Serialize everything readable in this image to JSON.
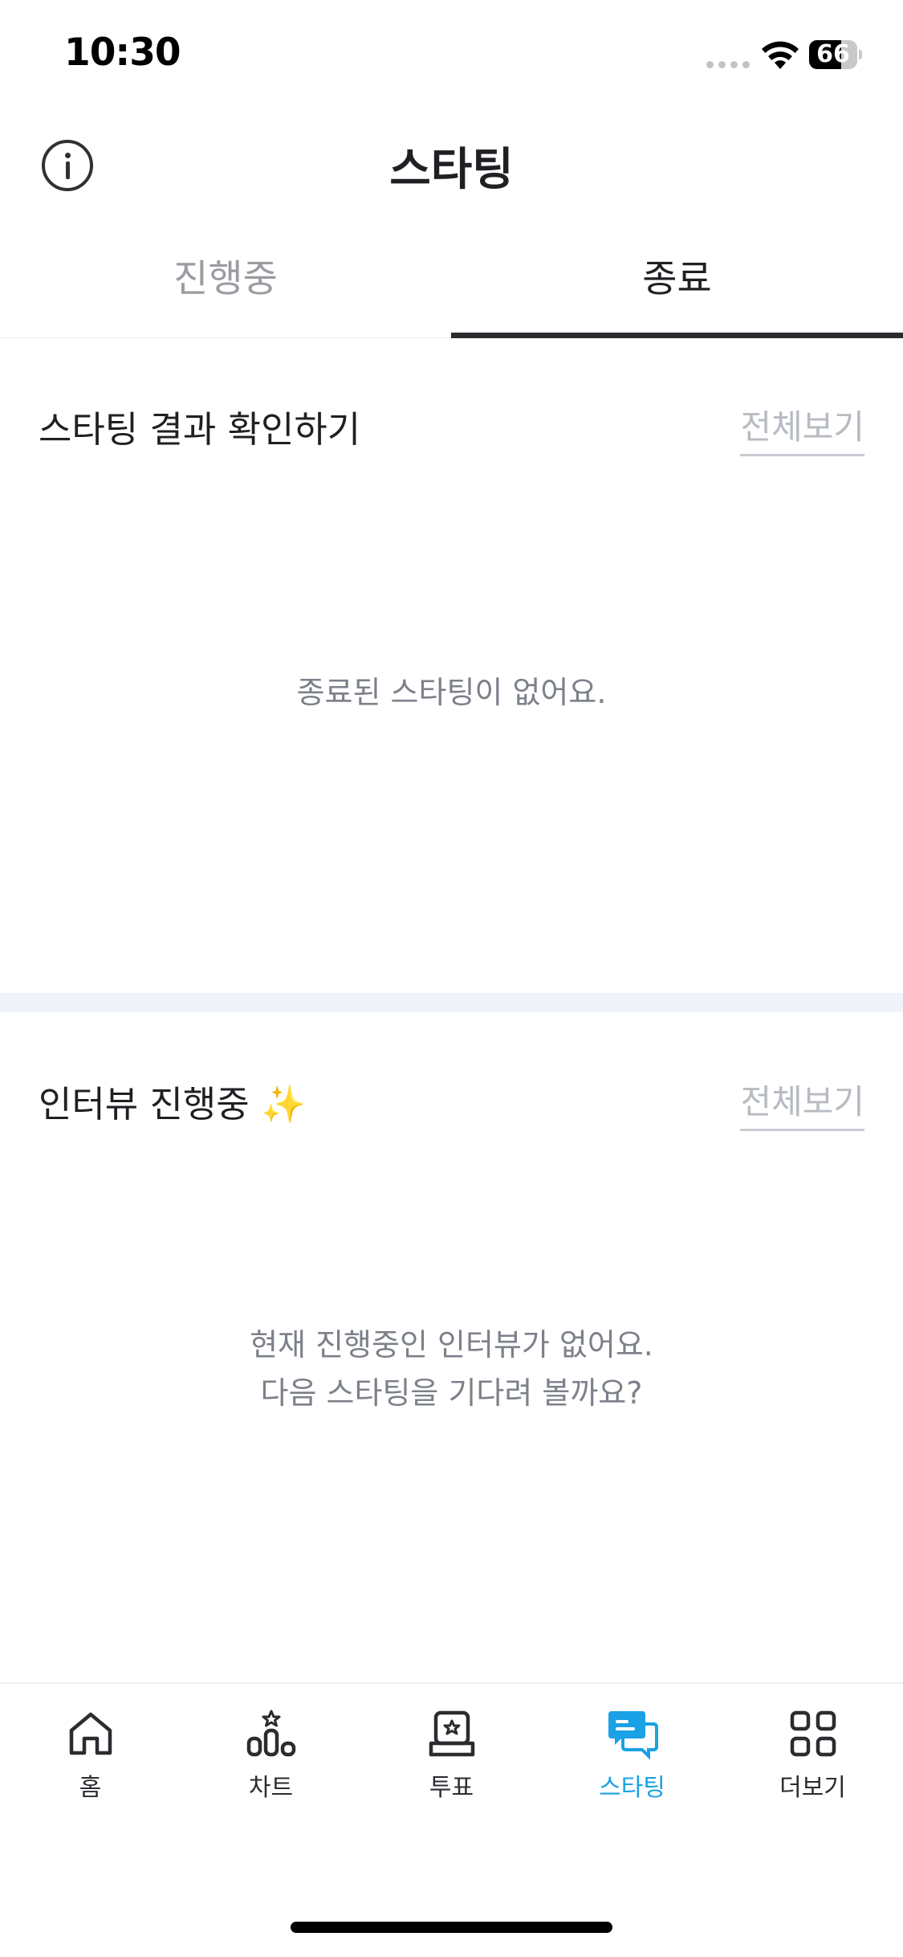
{
  "status_bar": {
    "time": "10:30",
    "battery_percent": 66,
    "battery_label": "66"
  },
  "header": {
    "title": "스타팅",
    "info_icon": "info-circle-icon"
  },
  "tabs": [
    {
      "label": "진행중",
      "active": false
    },
    {
      "label": "종료",
      "active": true
    }
  ],
  "results_section": {
    "title": "스타팅 결과 확인하기",
    "view_all_label": "전체보기",
    "empty_message": "종료된 스타팅이 없어요."
  },
  "interview_section": {
    "title": "인터뷰 진행중 ✨",
    "view_all_label": "전체보기",
    "empty_message_line1": "현재 진행중인 인터뷰가 없어요.",
    "empty_message_line2": "다음 스타팅을 기다려 볼까요?"
  },
  "bottom_nav": {
    "items": [
      {
        "label": "홈",
        "icon": "home-icon",
        "active": false
      },
      {
        "label": "차트",
        "icon": "chart-icon",
        "active": false
      },
      {
        "label": "투표",
        "icon": "vote-box-icon",
        "active": false
      },
      {
        "label": "스타팅",
        "icon": "chat-bubbles-icon",
        "active": true
      },
      {
        "label": "더보기",
        "icon": "grid-more-icon",
        "active": false
      }
    ],
    "active_color": "#1aa1e6",
    "inactive_color": "#2a2c30"
  }
}
